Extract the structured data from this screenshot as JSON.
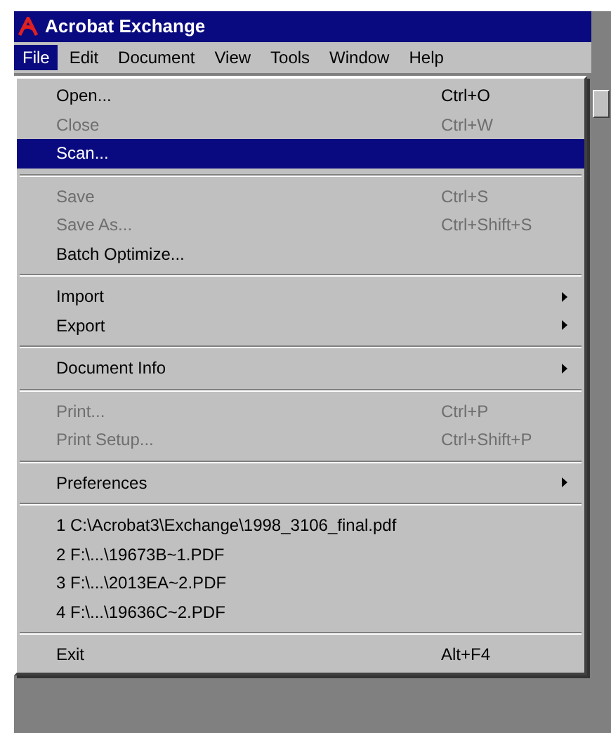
{
  "window": {
    "title": "Acrobat Exchange"
  },
  "menu_bar": [
    {
      "label": "File",
      "selected": true
    },
    {
      "label": "Edit",
      "selected": false
    },
    {
      "label": "Document",
      "selected": false
    },
    {
      "label": "View",
      "selected": false
    },
    {
      "label": "Tools",
      "selected": false
    },
    {
      "label": "Window",
      "selected": false
    },
    {
      "label": "Help",
      "selected": false
    }
  ],
  "file_menu": [
    {
      "kind": "item",
      "label": "Open...",
      "shortcut": "Ctrl+O",
      "disabled": false,
      "selected": false
    },
    {
      "kind": "item",
      "label": "Close",
      "shortcut": "Ctrl+W",
      "disabled": true,
      "selected": false
    },
    {
      "kind": "item",
      "label": "Scan...",
      "disabled": false,
      "selected": true
    },
    {
      "kind": "separator"
    },
    {
      "kind": "item",
      "label": "Save",
      "shortcut": "Ctrl+S",
      "disabled": true,
      "selected": false
    },
    {
      "kind": "item",
      "label": "Save As...",
      "shortcut": "Ctrl+Shift+S",
      "disabled": true,
      "selected": false
    },
    {
      "kind": "item",
      "label": "Batch Optimize...",
      "disabled": false,
      "selected": false
    },
    {
      "kind": "separator"
    },
    {
      "kind": "submenu",
      "label": "Import",
      "disabled": false,
      "selected": false
    },
    {
      "kind": "submenu",
      "label": "Export",
      "disabled": false,
      "selected": false
    },
    {
      "kind": "separator"
    },
    {
      "kind": "submenu",
      "label": "Document Info",
      "disabled": false,
      "selected": false
    },
    {
      "kind": "separator"
    },
    {
      "kind": "item",
      "label": "Print...",
      "shortcut": "Ctrl+P",
      "disabled": true,
      "selected": false
    },
    {
      "kind": "item",
      "label": "Print Setup...",
      "shortcut": "Ctrl+Shift+P",
      "disabled": true,
      "selected": false
    },
    {
      "kind": "separator"
    },
    {
      "kind": "submenu",
      "label": "Preferences",
      "disabled": false,
      "selected": false
    },
    {
      "kind": "separator"
    },
    {
      "kind": "item",
      "label": "1 C:\\Acrobat3\\Exchange\\1998_3106_final.pdf",
      "disabled": false,
      "selected": false
    },
    {
      "kind": "item",
      "label": "2 F:\\...\\19673B~1.PDF",
      "disabled": false,
      "selected": false
    },
    {
      "kind": "item",
      "label": "3 F:\\...\\2013EA~2.PDF",
      "disabled": false,
      "selected": false
    },
    {
      "kind": "item",
      "label": "4 F:\\...\\19636C~2.PDF",
      "disabled": false,
      "selected": false
    },
    {
      "kind": "separator"
    },
    {
      "kind": "item",
      "label": "Exit",
      "shortcut": "Alt+F4",
      "disabled": false,
      "selected": false
    }
  ]
}
